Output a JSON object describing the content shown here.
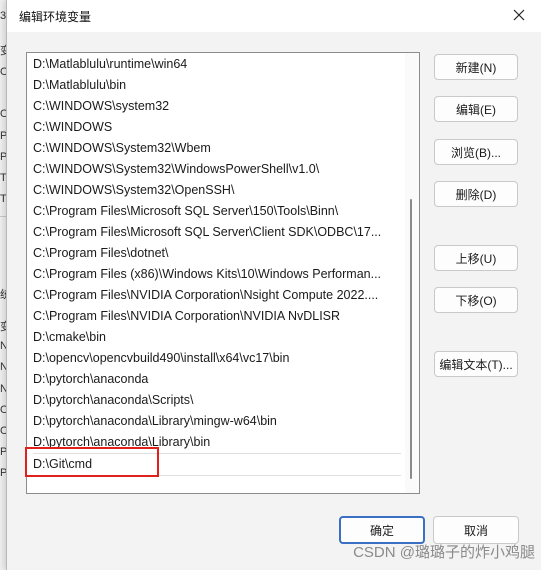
{
  "window": {
    "title": "编辑环境变量"
  },
  "paths": [
    "D:\\Matlablulu\\runtime\\win64",
    "D:\\Matlablulu\\bin",
    "C:\\WINDOWS\\system32",
    "C:\\WINDOWS",
    "C:\\WINDOWS\\System32\\Wbem",
    "C:\\WINDOWS\\System32\\WindowsPowerShell\\v1.0\\",
    "C:\\WINDOWS\\System32\\OpenSSH\\",
    "C:\\Program Files\\Microsoft SQL Server\\150\\Tools\\Binn\\",
    "C:\\Program Files\\Microsoft SQL Server\\Client SDK\\ODBC\\17...",
    "C:\\Program Files\\dotnet\\",
    "C:\\Program Files (x86)\\Windows Kits\\10\\Windows Performan...",
    "C:\\Program Files\\NVIDIA Corporation\\Nsight Compute 2022....",
    "C:\\Program Files\\NVIDIA Corporation\\NVIDIA NvDLISR",
    "D:\\cmake\\bin",
    "D:\\opencv\\opencvbuild490\\install\\x64\\vc17\\bin",
    "D:\\pytorch\\anaconda",
    "D:\\pytorch\\anaconda\\Scripts\\",
    "D:\\pytorch\\anaconda\\Library\\mingw-w64\\bin",
    "D:\\pytorch\\anaconda\\Library\\bin",
    "D:\\Git\\cmd"
  ],
  "buttons": {
    "new": "新建(N)",
    "edit": "编辑(E)",
    "browse": "浏览(B)...",
    "delete": "删除(D)",
    "move_up": "上移(U)",
    "move_down": "下移(O)",
    "edit_text": "编辑文本(T)...",
    "ok": "确定",
    "cancel": "取消"
  },
  "background_fragments": [
    "34",
    "变",
    "O",
    "O",
    "Pa",
    "Py",
    "TE",
    "TN",
    "统",
    "变",
    "N",
    "N",
    "N",
    "O",
    "O",
    "Pa",
    "PA"
  ],
  "watermark": "CSDN @璐璐子的炸小鸡腿",
  "colors": {
    "highlight": "#e0201b",
    "primary_border": "#3a6fc4"
  }
}
